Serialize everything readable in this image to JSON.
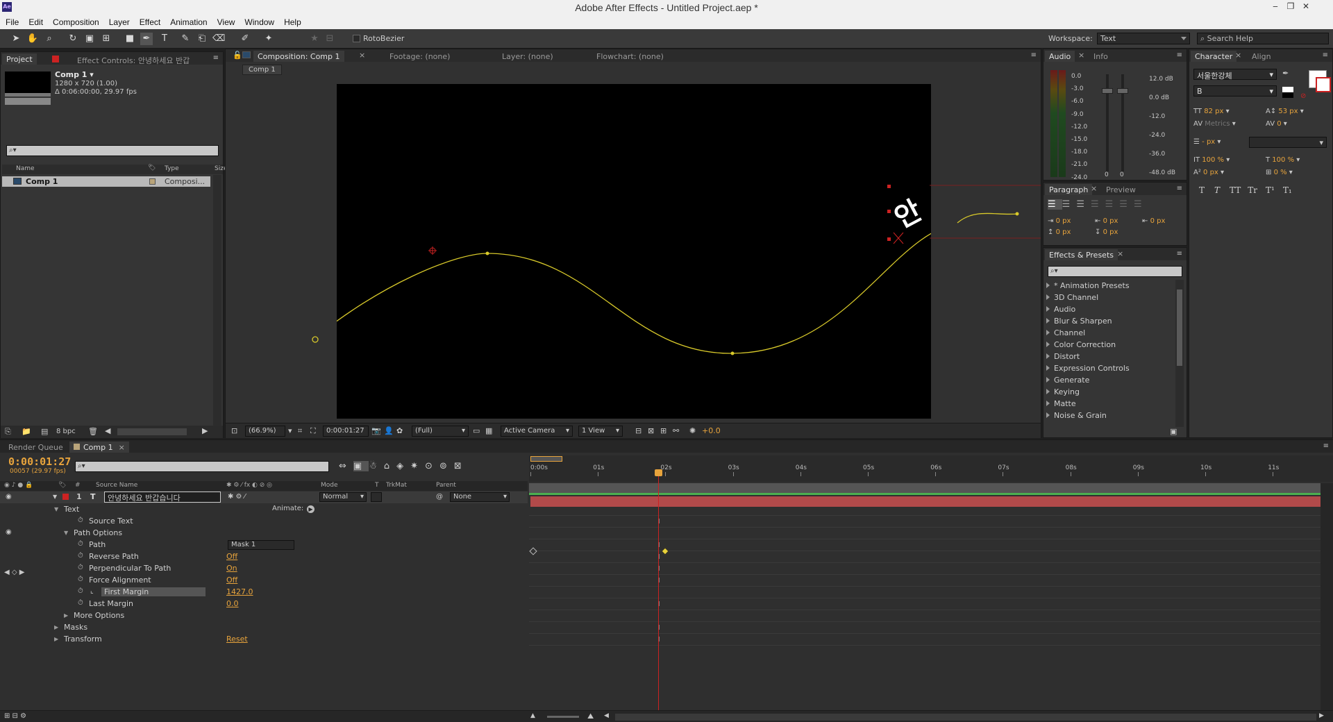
{
  "window": {
    "title": "Adobe After Effects - Untitled Project.aep *",
    "app_icon": "Ae"
  },
  "menu": [
    "File",
    "Edit",
    "Composition",
    "Layer",
    "Effect",
    "Animation",
    "View",
    "Window",
    "Help"
  ],
  "toolbar": {
    "rotobezier_label": "RotoBezier",
    "workspace_label": "Workspace:",
    "workspace_value": "Text",
    "search_placeholder": "Search Help"
  },
  "project": {
    "tab_project": "Project",
    "tab_effect_controls": "Effect Controls: 안녕하세요 반갑",
    "comp_name": "Comp 1 ▾",
    "comp_size": "1280 x 720 (1.00)",
    "comp_duration": "Δ 0:06:00:00, 29.97 fps",
    "col_name": "Name",
    "col_type": "Type",
    "col_size": "Size",
    "item_name": "Comp 1",
    "item_type": "Composi...",
    "bpc": "8 bpc"
  },
  "viewer": {
    "tabs": [
      "Composition: Comp 1",
      "Footage: (none)",
      "Layer: (none)",
      "Flowchart: (none)"
    ],
    "subtab": "Comp 1",
    "zoom": "(66.9%)",
    "timecode": "0:00:01:27",
    "resolution": "(Full)",
    "camera": "Active Camera",
    "views": "1 View",
    "exposure": "+0.0",
    "overlay_text": "안"
  },
  "audio": {
    "tabs": [
      "Audio",
      "Info"
    ],
    "left_scale": [
      "0.0",
      "-3.0",
      "-6.0",
      "-9.0",
      "-12.0",
      "-15.0",
      "-18.0",
      "-21.0",
      "-24.0"
    ],
    "right_scale": [
      "12.0 dB",
      "0.0 dB",
      "-12.0",
      "-24.0",
      "-36.0",
      "-48.0 dB"
    ],
    "slider_zeros": [
      "0",
      "0"
    ]
  },
  "paragraph": {
    "tabs": [
      "Paragraph",
      "Preview"
    ],
    "values": [
      "0 px",
      "0 px",
      "0 px",
      "0 px",
      "0 px"
    ]
  },
  "effects": {
    "tab": "Effects & Presets",
    "items": [
      "* Animation Presets",
      "3D Channel",
      "Audio",
      "Blur & Sharpen",
      "Channel",
      "Color Correction",
      "Distort",
      "Expression Controls",
      "Generate",
      "Keying",
      "Matte",
      "Noise & Grain"
    ]
  },
  "character": {
    "tabs": [
      "Character",
      "Align"
    ],
    "font": "서울한강체",
    "style": "B",
    "size": "82 px",
    "leading": "53 px",
    "kerning": "Metrics",
    "tracking": "0",
    "stroke": "- px",
    "vscale": "100 %",
    "hscale": "100 %",
    "baseline": "0 px",
    "tsume": "0 %",
    "style_buttons": [
      "T",
      "T",
      "TT",
      "Tr",
      "T¹",
      "T₁"
    ]
  },
  "timeline": {
    "tabs": [
      "Render Queue",
      "Comp 1"
    ],
    "timecode": "0:00:01:27",
    "frame_info": "00057 (29.97 fps)",
    "col_source": "Source Name",
    "col_mode": "Mode",
    "col_t": "T",
    "col_trkmat": "TrkMat",
    "col_parent": "Parent",
    "layer_num": "1",
    "layer_name": "안녕하세요 반갑습니다",
    "layer_mode": "Normal",
    "layer_parent": "None",
    "animate_label": "Animate:",
    "ruler": [
      "0:00s",
      "01s",
      "02s",
      "03s",
      "04s",
      "05s",
      "06s",
      "07s",
      "08s",
      "09s",
      "10s",
      "11s"
    ],
    "properties": [
      {
        "label": "Text",
        "indent": 0,
        "twirl": "open",
        "value": ""
      },
      {
        "label": "Source Text",
        "indent": 2,
        "twirl": "",
        "value": ""
      },
      {
        "label": "Path Options",
        "indent": 1,
        "twirl": "open",
        "value": ""
      },
      {
        "label": "Path",
        "indent": 2,
        "twirl": "",
        "value": "Mask 1"
      },
      {
        "label": "Reverse Path",
        "indent": 2,
        "twirl": "",
        "value": "Off"
      },
      {
        "label": "Perpendicular To Path",
        "indent": 2,
        "twirl": "",
        "value": "On"
      },
      {
        "label": "Force Alignment",
        "indent": 2,
        "twirl": "",
        "value": "Off"
      },
      {
        "label": "First Margin",
        "indent": 2,
        "twirl": "",
        "value": "1427.0"
      },
      {
        "label": "Last Margin",
        "indent": 2,
        "twirl": "",
        "value": "0.0"
      },
      {
        "label": "More Options",
        "indent": 1,
        "twirl": "closed",
        "value": ""
      },
      {
        "label": "Masks",
        "indent": 0,
        "twirl": "closed",
        "value": ""
      },
      {
        "label": "Transform",
        "indent": 0,
        "twirl": "closed",
        "value": "Reset"
      }
    ]
  }
}
